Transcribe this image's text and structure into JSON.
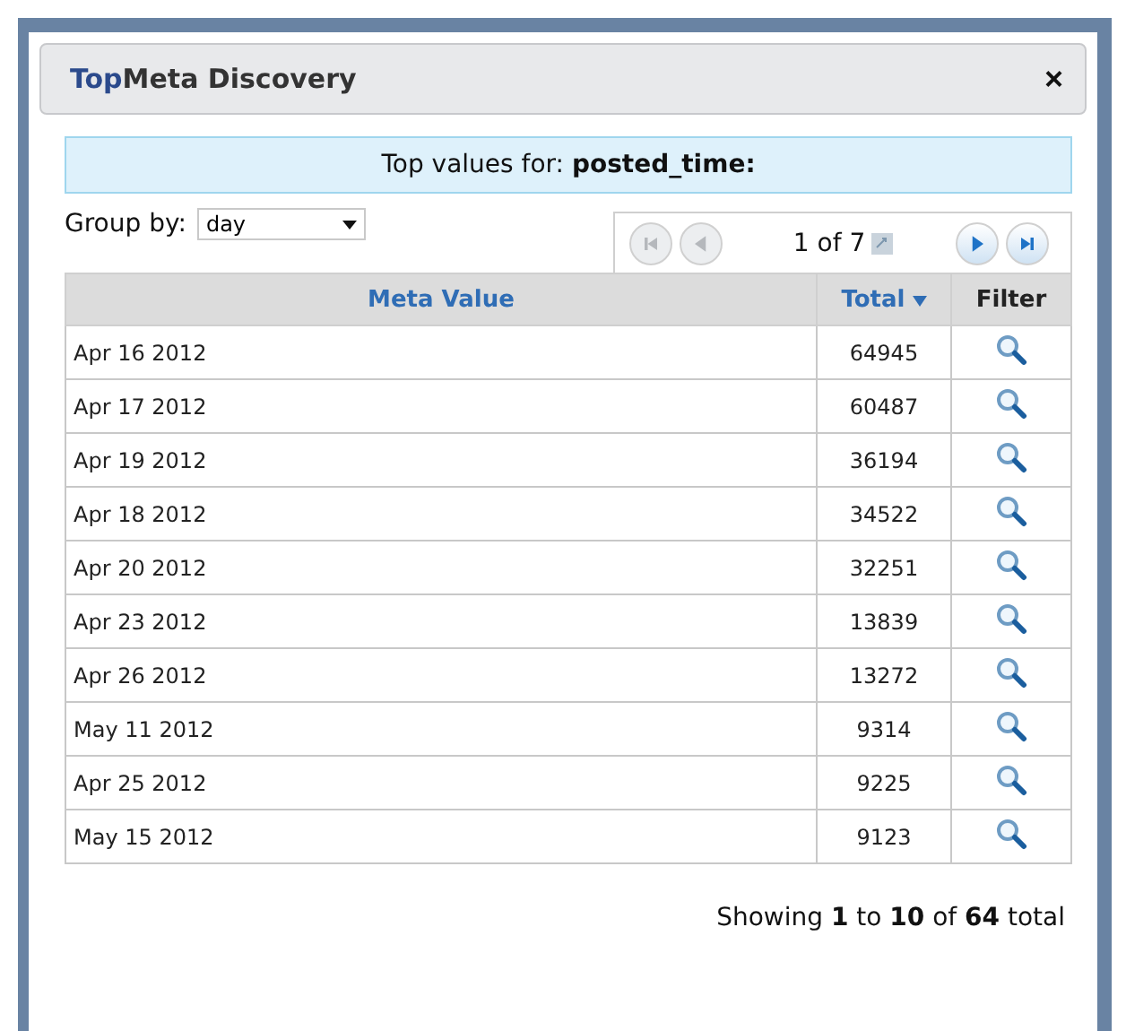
{
  "window": {
    "title_parts": [
      {
        "text": "Top",
        "accent": true
      },
      {
        "text": "Meta Discovery",
        "accent": false
      }
    ],
    "close": "×"
  },
  "banner": "Top values for: **posted_time:**",
  "group_by": {
    "label": "Group by:",
    "value": "day"
  },
  "pager": {
    "buttons": [
      {
        "kind": "first",
        "disabled": true
      },
      {
        "kind": "prev",
        "disabled": true
      },
      {
        "kind": "next",
        "disabled": false
      },
      {
        "kind": "last",
        "disabled": false
      }
    ],
    "page": "1 of 7"
  },
  "table": {
    "columns": [
      {
        "label": "Meta Value",
        "sorted": false,
        "link": true
      },
      {
        "label": "Total",
        "sorted": true,
        "link": true
      },
      {
        "label": "Filter",
        "sorted": false,
        "link": false
      }
    ],
    "rows": [
      {
        "value": "Apr 16 2012",
        "total": "64945"
      },
      {
        "value": "Apr 17 2012",
        "total": "60487"
      },
      {
        "value": "Apr 19 2012",
        "total": "36194"
      },
      {
        "value": "Apr 18 2012",
        "total": "34522"
      },
      {
        "value": "Apr 20 2012",
        "total": "32251"
      },
      {
        "value": "Apr 23 2012",
        "total": "13839"
      },
      {
        "value": "Apr 26 2012",
        "total": "13272"
      },
      {
        "value": "May 11 2012",
        "total": "9314"
      },
      {
        "value": "Apr 25 2012",
        "total": "9225"
      },
      {
        "value": "May 15 2012",
        "total": "9123"
      }
    ]
  },
  "footer": "Showing **1** to **10** of **64** total"
}
